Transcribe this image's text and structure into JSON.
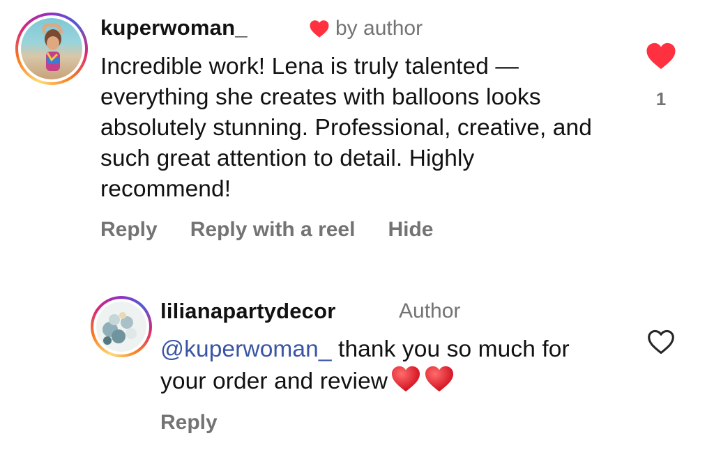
{
  "comments": [
    {
      "username": "kuperwoman_",
      "by_author_label": "by author",
      "text": "Incredible work! Lena is truly talented — everything she creates with balloons looks absolutely stunning. Professional, creative, and such great attention to detail. Highly recommend!",
      "like_count": "1",
      "liked": true,
      "actions": [
        "Reply",
        "Reply with a reel",
        "Hide"
      ]
    },
    {
      "username": "lilianapartydecor",
      "author_label": "Author",
      "mention": "@kuperwoman_",
      "text": " thank you so much for your order and review",
      "liked": false,
      "actions": [
        "Reply"
      ]
    }
  ],
  "colors": {
    "heart_red": "#ff3040",
    "secondary_text": "#737373",
    "mention": "#3a55a5"
  },
  "icons": {
    "liked": "heart-filled-icon",
    "unliked": "heart-outline-icon",
    "emoji": "red-heart-emoji-icon"
  }
}
